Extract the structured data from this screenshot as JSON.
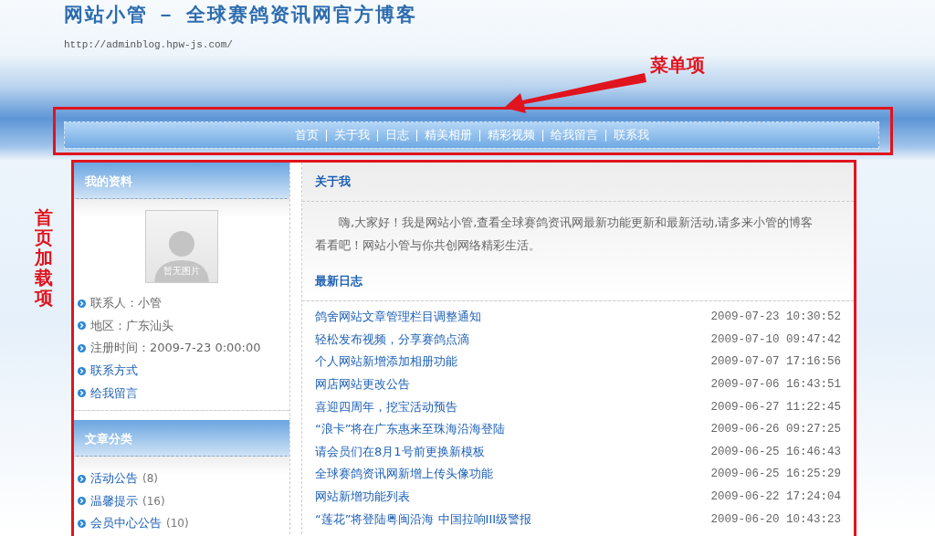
{
  "header": {
    "title": "网站小管 － 全球赛鸽资讯网官方博客",
    "url": "http://adminblog.hpw-js.com/"
  },
  "annotations": {
    "menu_label": "菜单项",
    "content_label": "首页加载项"
  },
  "nav": [
    "首页",
    "关于我",
    "日志",
    "精美相册",
    "精彩视频",
    "给我留言",
    "联系我"
  ],
  "profile": {
    "title": "我的资料",
    "photo_caption": "暂无图片",
    "items": [
      {
        "kind": "info",
        "text": "联系人：小管"
      },
      {
        "kind": "info",
        "text": "地区：广东汕头"
      },
      {
        "kind": "info",
        "text": "注册时间：2009-7-23 0:00:00"
      },
      {
        "kind": "link",
        "text": "联系方式"
      },
      {
        "kind": "link",
        "text": "给我留言"
      }
    ]
  },
  "categories": {
    "title": "文章分类",
    "items": [
      {
        "name": "活动公告",
        "count": "(8)"
      },
      {
        "name": "温馨提示",
        "count": "(16)"
      },
      {
        "name": "会员中心公告",
        "count": "(10)"
      }
    ]
  },
  "about": {
    "title": "关于我",
    "text": "嗨,大家好！我是网站小管,查看全球赛鸽资讯网最新功能更新和最新活动,请多来小管的博客看看吧！网站小管与你共创网络精彩生活。"
  },
  "latest": {
    "title": "最新日志",
    "rows": [
      {
        "title": "鸽舍网站文章管理栏目调整通知",
        "time": "2009-07-23 10:30:52"
      },
      {
        "title": "轻松发布视频，分享赛鸽点滴",
        "time": "2009-07-10 09:47:42"
      },
      {
        "title": "个人网站新增添加相册功能",
        "time": "2009-07-07 17:16:56"
      },
      {
        "title": "网店网站更改公告",
        "time": "2009-07-06 16:43:51"
      },
      {
        "title": "喜迎四周年，挖宝活动预告",
        "time": "2009-06-27 11:22:45"
      },
      {
        "title": "“浪卡”将在广东惠来至珠海沿海登陆",
        "time": "2009-06-26 09:27:25"
      },
      {
        "title": "请会员们在8月1号前更换新模板",
        "time": "2009-06-25 16:46:43"
      },
      {
        "title": "全球赛鸽资讯网新增上传头像功能",
        "time": "2009-06-25 16:25:29"
      },
      {
        "title": "网站新增功能列表",
        "time": "2009-06-22 17:24:04"
      },
      {
        "title": "“莲花”将登陆粤闽沿海  中国拉响III级警报",
        "time": "2009-06-20 10:43:23"
      }
    ]
  }
}
